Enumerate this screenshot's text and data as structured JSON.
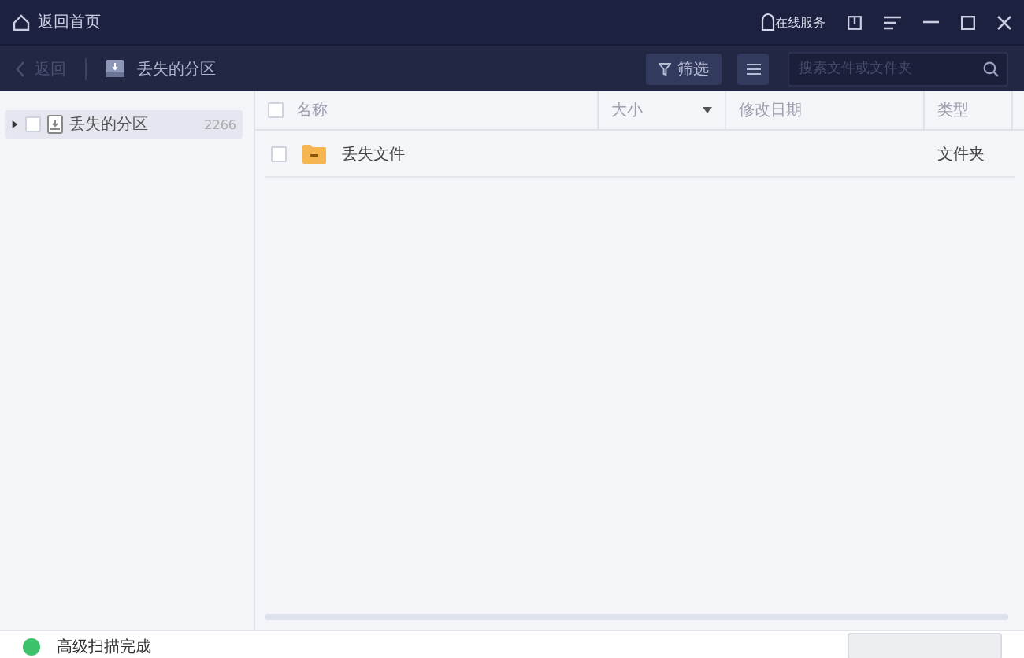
{
  "title_bar": {
    "home_link": "返回首页",
    "service": "在线服务"
  },
  "toolbar": {
    "back": "返回",
    "location": "丢失的分区",
    "filter": "筛选",
    "search": {
      "placeholder": "搜索文件或文件夹"
    }
  },
  "sidebar": {
    "items": [
      {
        "label": "丢失的分区",
        "count": "2266",
        "selected": true,
        "expanded": false,
        "checked": false
      }
    ]
  },
  "table": {
    "select_all_checked": false,
    "columns": [
      "名称",
      "大小",
      "修改日期",
      "类型"
    ],
    "rows": [
      {
        "name": "丢失文件",
        "type": "文件夹",
        "checked": false
      }
    ]
  },
  "status_bar": {
    "text": "高级扫描完成",
    "action_disabled": true
  }
}
